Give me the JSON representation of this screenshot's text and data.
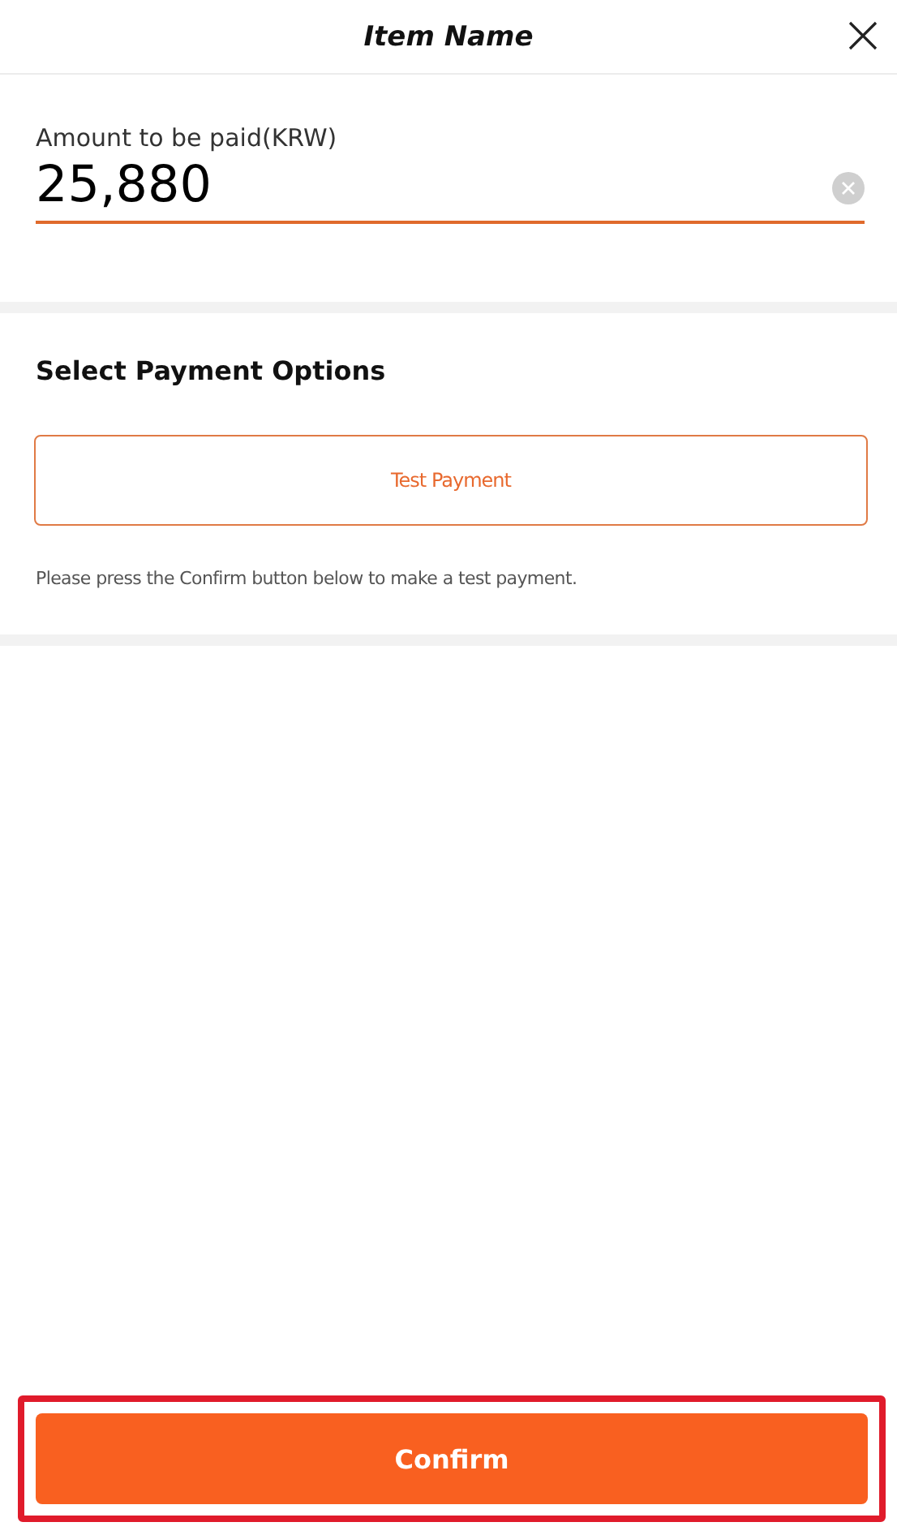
{
  "header": {
    "title": "Item Name"
  },
  "amount": {
    "label": "Amount to be paid(KRW)",
    "value": "25,880"
  },
  "payment_options": {
    "title": "Select Payment Options",
    "options": [
      {
        "label": "Test Payment",
        "selected": true
      }
    ],
    "note": "Please press the Confirm button below to make a test payment."
  },
  "confirm_button": {
    "label": "Confirm",
    "highlighted": true
  }
}
